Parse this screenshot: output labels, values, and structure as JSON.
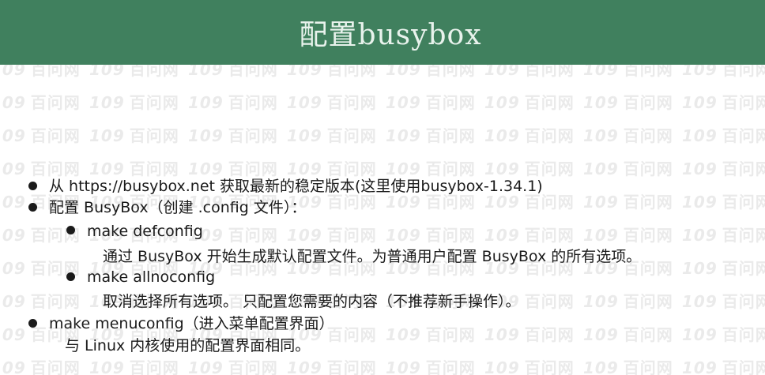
{
  "header": {
    "title": "配置busybox",
    "background": "#40805e"
  },
  "watermark": {
    "text": "109 百问网"
  },
  "content": {
    "item1": "从 https://busybox.net 获取最新的稳定版本(这里使用busybox-1.34.1)",
    "item2": "配置 BusyBox（创建 .config 文件）：",
    "sub1_label": "make defconfig",
    "sub1_desc": "通过 BusyBox 开始生成默认配置文件。为普通用户配置 BusyBox 的所有选项。",
    "sub2_label": "make  allnoconfig",
    "sub2_desc": "取消选择所有选项。 只配置您需要的内容（不推荐新手操作）。",
    "item3": "make menuconfig（进入菜单配置界面）",
    "item3_desc": "与 Linux 内核使用的配置界面相同。"
  }
}
